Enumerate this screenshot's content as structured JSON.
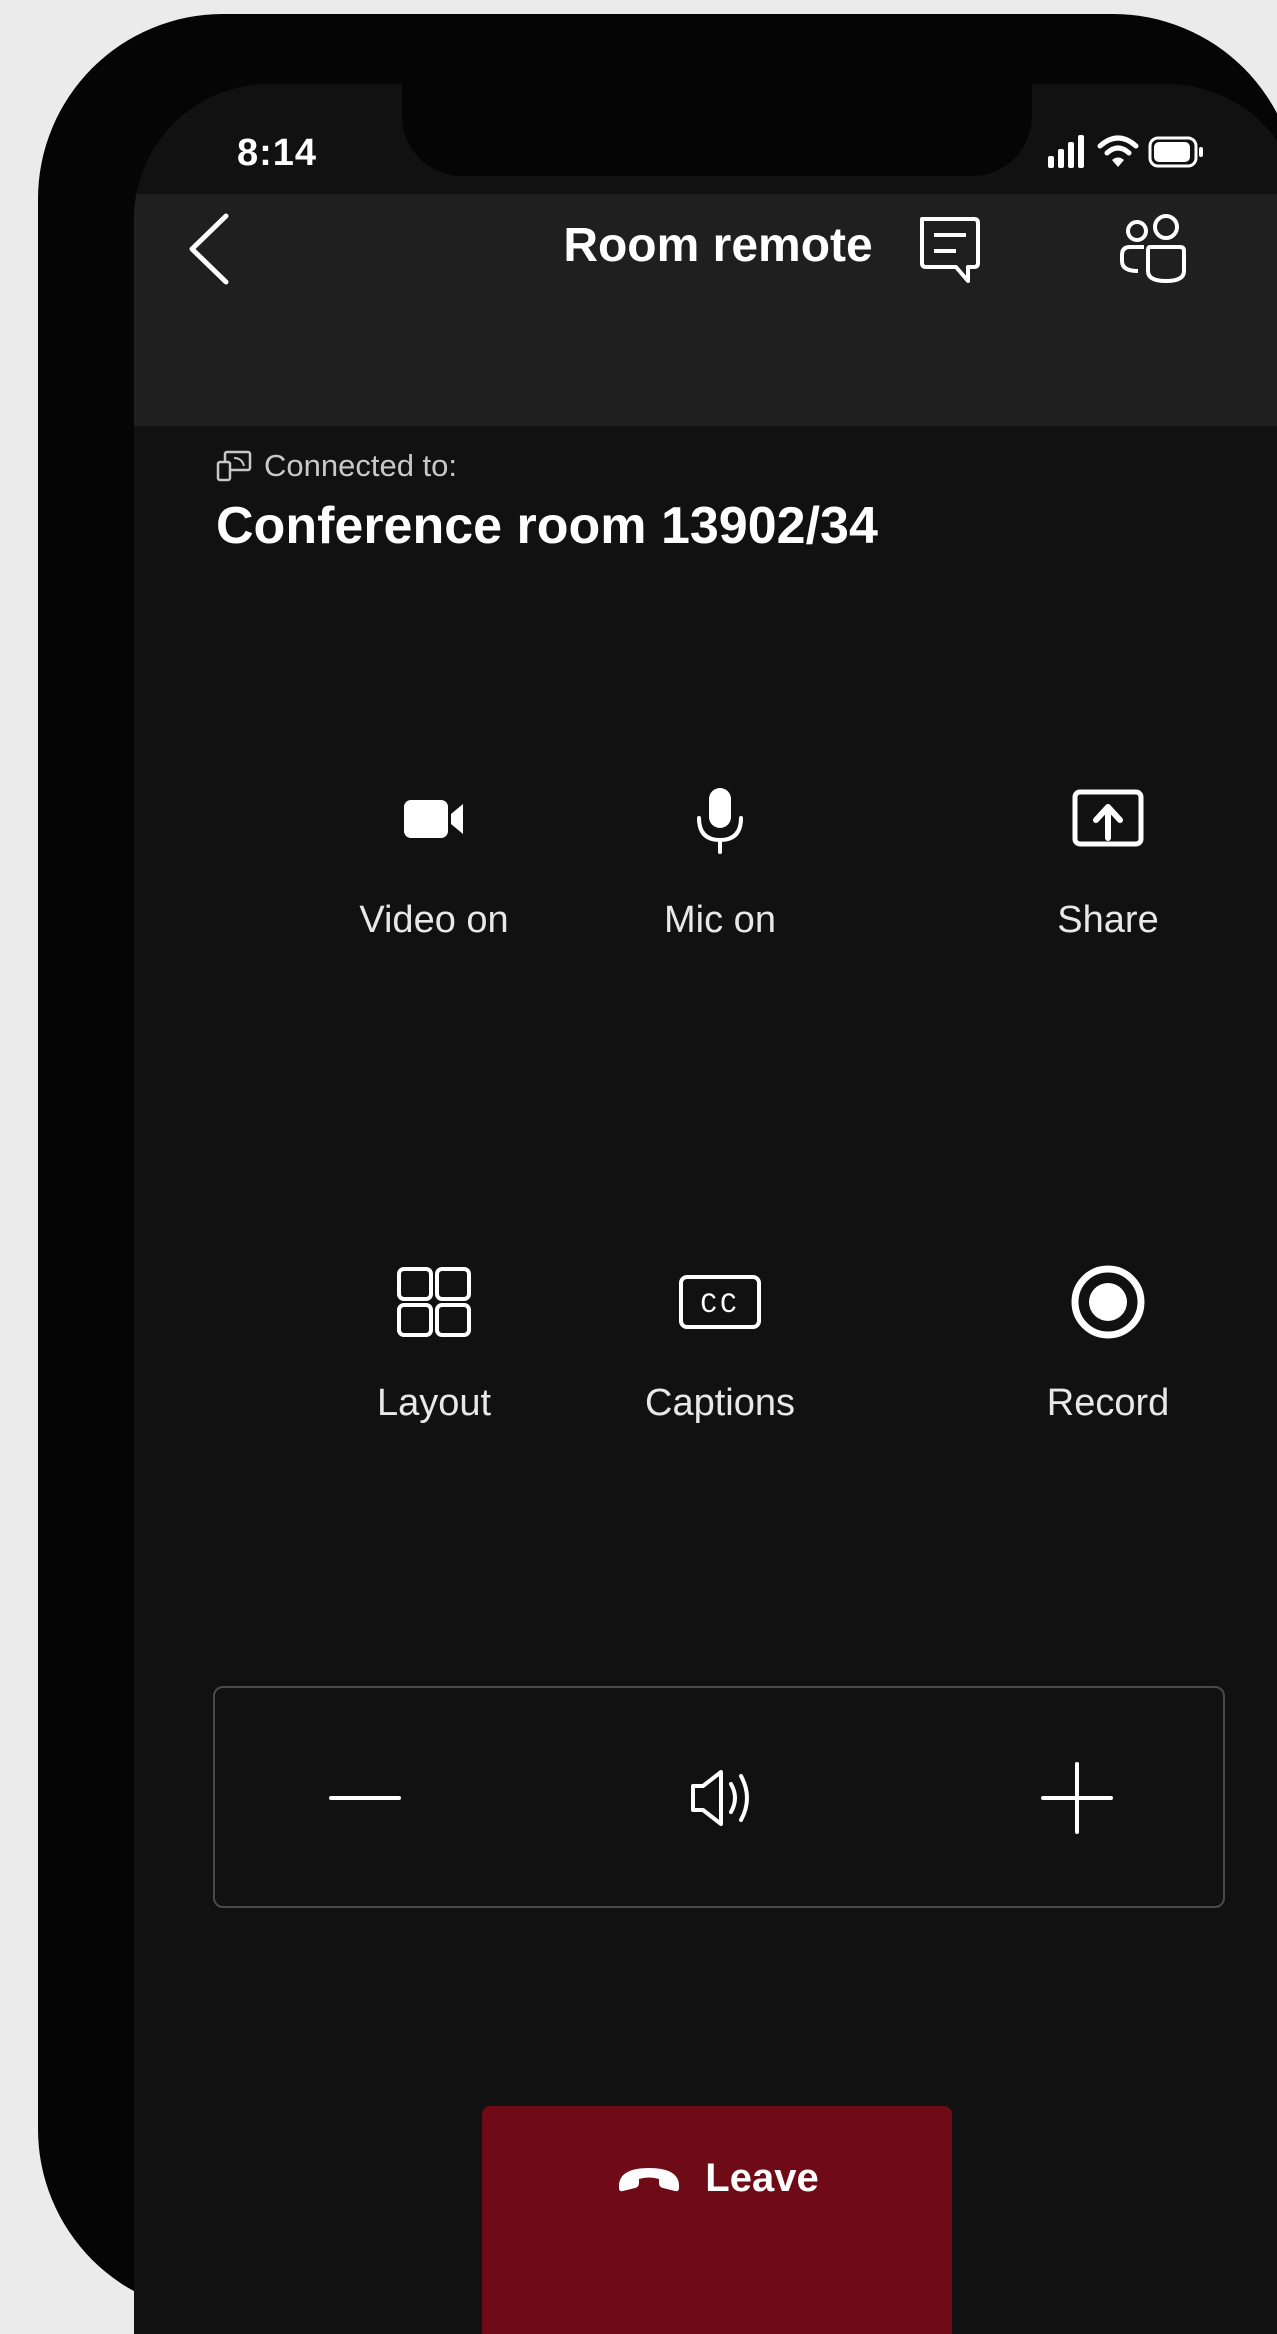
{
  "status_bar": {
    "time": "8:14"
  },
  "header": {
    "title": "Room remote"
  },
  "connection": {
    "label": "Connected to:",
    "room": "Conference room 13902/34"
  },
  "controls": [
    {
      "label": "Video on",
      "icon": "video-camera-icon"
    },
    {
      "label": "Mic on",
      "icon": "microphone-icon"
    },
    {
      "label": "Share",
      "icon": "share-screen-icon"
    },
    {
      "label": "Layout",
      "icon": "layout-grid-icon"
    },
    {
      "label": "Captions",
      "icon": "captions-icon"
    },
    {
      "label": "Record",
      "icon": "record-icon"
    }
  ],
  "volume": {
    "icon": "speaker-icon"
  },
  "leave_button": {
    "label": "Leave",
    "icon": "hang-up-icon"
  },
  "colors": {
    "background": "#111111",
    "header": "#1f1f1f",
    "leave": "#6f0a17",
    "text": "#ffffff"
  }
}
